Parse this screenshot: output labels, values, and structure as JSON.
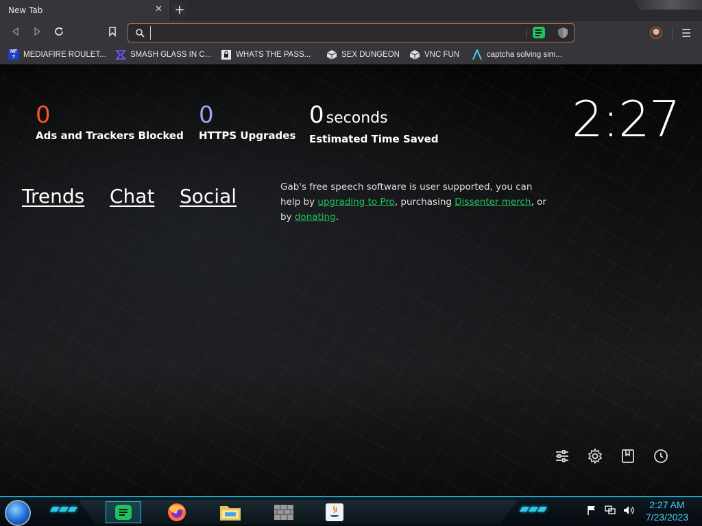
{
  "tab": {
    "title": "New Tab"
  },
  "address_bar": {
    "value": "",
    "placeholder": ""
  },
  "bookmarks": [
    {
      "label": "MEDIAFIRE ROULET...",
      "icon": "mediafire-icon"
    },
    {
      "label": "SMASH GLASS IN C...",
      "icon": "smash-icon"
    },
    {
      "label": "WHATS THE PASS...",
      "icon": "lock-icon"
    },
    {
      "label": "SEX DUNGEON",
      "icon": "cube-icon"
    },
    {
      "label": "VNC FUN",
      "icon": "cube-icon"
    },
    {
      "label": "captcha solving sim...",
      "icon": "caret-icon"
    }
  ],
  "stats": {
    "ads": {
      "value": "0",
      "label": "Ads and Trackers Blocked"
    },
    "https": {
      "value": "0",
      "label": "HTTPS Upgrades"
    },
    "time": {
      "value": "0",
      "unit": "seconds",
      "label": "Estimated Time Saved"
    }
  },
  "clock": "2:27",
  "nav_links": {
    "trends": "Trends",
    "chat": "Chat",
    "social": "Social"
  },
  "gab_note": {
    "part1": "Gab's free speech software is user supported, you can help by ",
    "link1": "upgrading to Pro",
    "part2": ", purchasing ",
    "link2": "Dissenter merch",
    "part3": ", or by ",
    "link3": "donating",
    "part4": "."
  },
  "taskbar": {
    "time": "2:27 AM",
    "date": "7/23/2023"
  },
  "colors": {
    "ads_count": "#fb542b",
    "https_count": "#a0a5eb",
    "gab_green": "#21c15b",
    "accent_cyan": "#2cc9e8",
    "url_border": "#c0703a"
  }
}
